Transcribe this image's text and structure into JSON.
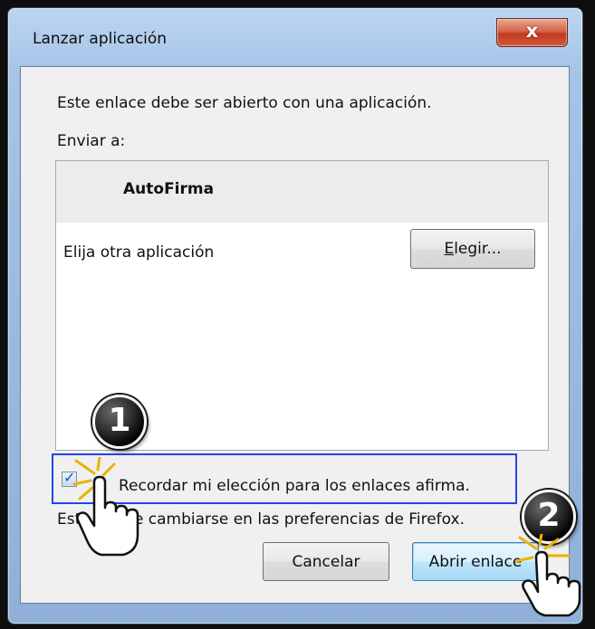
{
  "window": {
    "title": "Lanzar aplicación",
    "close_glyph": "x"
  },
  "dialog": {
    "description": "Este enlace debe ser abierto con una aplicación.",
    "send_to_label": "Enviar a:",
    "apps": [
      {
        "name": "AutoFirma",
        "selected": true,
        "icon": "autofirma-app-icon"
      }
    ],
    "other_app_label": "Elija otra aplicación",
    "choose_button": {
      "accel": "E",
      "rest": "legir..."
    },
    "remember_checkbox": {
      "checked": true,
      "label": "Recordar mi elección para los enlaces afirma."
    },
    "footer_note": "Esto puede cambiarse en las preferencias de Firefox.",
    "cancel_button": "Cancelar",
    "open_button": "Abrir enlace"
  },
  "annotations": {
    "step1": "1",
    "step2": "2",
    "highlight_color": "#2244ee",
    "cursor_icon": "hand-pointer-icon"
  }
}
